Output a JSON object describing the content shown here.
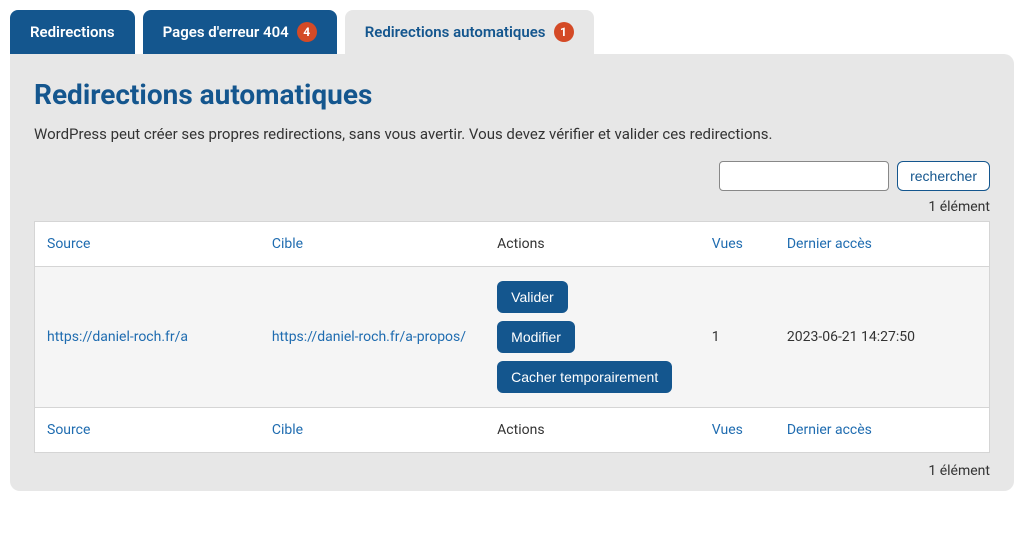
{
  "tabs": {
    "redirections": {
      "label": "Redirections"
    },
    "errors404": {
      "label": "Pages d'erreur 404",
      "count": "4"
    },
    "auto": {
      "label": "Redirections automatiques",
      "count": "1"
    }
  },
  "page": {
    "title": "Redirections automatiques",
    "description": "WordPress peut créer ses propres redirections, sans vous avertir. Vous devez vérifier et valider ces redirections."
  },
  "search": {
    "button": "rechercher",
    "value": ""
  },
  "count_label_top": "1 élément",
  "count_label_bottom": "1 élément",
  "columns": {
    "source": "Source",
    "target": "Cible",
    "actions": "Actions",
    "views": "Vues",
    "last_access": "Dernier accès"
  },
  "rows": [
    {
      "source": "https://daniel-roch.fr/a",
      "target": "https://daniel-roch.fr/a-propos/",
      "views": "1",
      "last_access": "2023-06-21 14:27:50"
    }
  ],
  "actions": {
    "validate": "Valider",
    "modify": "Modifier",
    "hide": "Cacher temporairement"
  }
}
